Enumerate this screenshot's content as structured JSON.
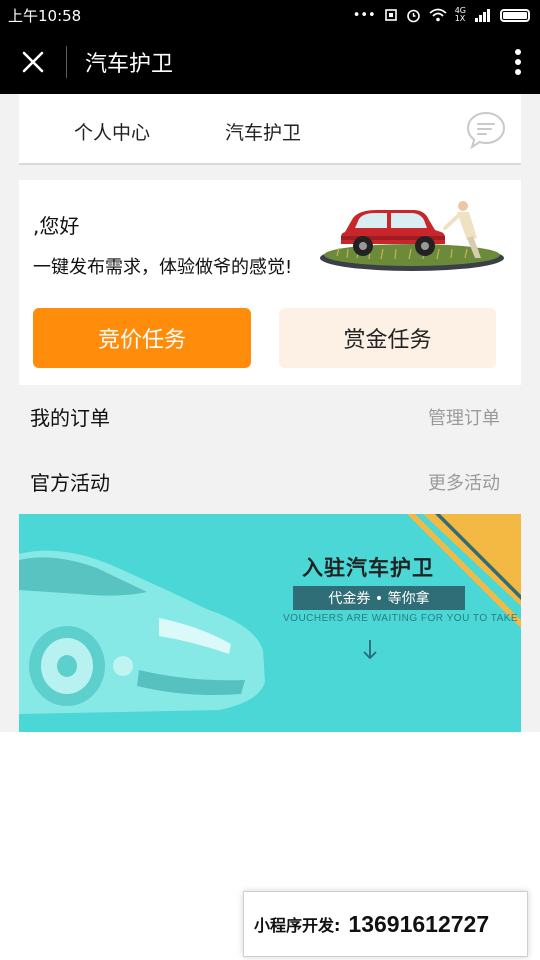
{
  "status_bar": {
    "time": "上午10:58",
    "signal_4g": "4G",
    "signal_1x": "1X"
  },
  "title_bar": {
    "title": "汽车护卫"
  },
  "tabs": [
    {
      "label": "个人中心"
    },
    {
      "label": "汽车护卫"
    }
  ],
  "hero": {
    "greeting": ",您好",
    "slogan": "一键发布需求，体验做爷的感觉!",
    "bid_button": "竞价任务",
    "bounty_button": "赏金任务"
  },
  "orders": {
    "title": "我的订单",
    "link": "管理订单"
  },
  "activities": {
    "title": "官方活动",
    "link": "更多活动"
  },
  "banner": {
    "title": "入驻汽车护卫",
    "pill": "代金券 • 等你拿",
    "subtitle": "VOUCHERS ARE WAITING FOR YOU TO TAKE"
  },
  "contact": {
    "label": "小程序开发:",
    "phone": "13691612727"
  },
  "colors": {
    "accent": "#ff8c0a",
    "banner_bg": "#4ad7d6",
    "bounty_bg": "#fdf1e6"
  }
}
